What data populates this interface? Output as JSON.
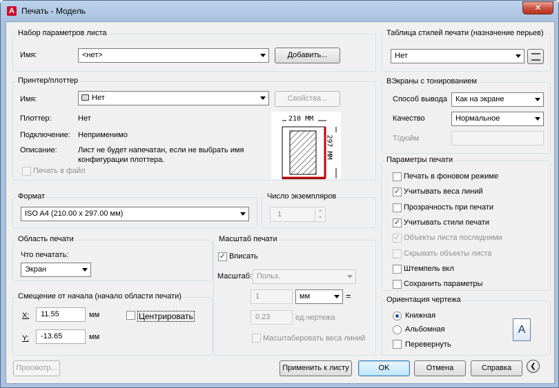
{
  "window": {
    "title": "Печать - Модель",
    "app_logo": "A",
    "close_symbol": "✕"
  },
  "page_setup": {
    "title": "Набор параметров листа",
    "name_label": "Имя:",
    "name_value": "<нет>",
    "add_button": "Добавить..."
  },
  "printer": {
    "title": "Принтер/плоттер",
    "name_label": "Имя:",
    "name_value": "Нет",
    "properties_button": "Свойства...",
    "plotter_label": "Плоттер:",
    "plotter_value": "Нет",
    "connection_label": "Подключение:",
    "connection_value": "Неприменимо",
    "description_label": "Описание:",
    "description_line1": "Лист не будет напечатан, если не выбрать имя",
    "description_line2": "конфигурации плоттера.",
    "print_to_file": "Печать в файл",
    "preview_width": "210 ММ",
    "preview_height": "297 ММ"
  },
  "paper_size": {
    "title": "Формат",
    "value": "ISO A4 (210.00 x 297.00 мм)"
  },
  "copies": {
    "title": "Число экземпляров",
    "value": "1"
  },
  "plot_area": {
    "title": "Область печати",
    "what_label": "Что печатать:",
    "what_value": "Экран"
  },
  "plot_offset": {
    "title": "Смещение от начала (начало области печати)",
    "x_label": "X:",
    "x_value": "11.55",
    "x_unit": "мм",
    "y_label": "Y:",
    "y_value": "-13.65",
    "y_unit": "мм",
    "center_label": "Центрировать"
  },
  "plot_scale": {
    "title": "Масштаб печати",
    "fit_label": "Вписать",
    "scale_label": "Масштаб:",
    "scale_value": "Польз.",
    "value1": "1",
    "unit_value": "мм",
    "equals": "=",
    "value2": "0.23",
    "units_label": "ед.чертежа",
    "scale_lineweights": "Масштабировать веса линий"
  },
  "style_table": {
    "title": "Таблица стилей печати (назначение перьев)",
    "value": "Нет"
  },
  "shaded": {
    "title": "ВЭкраны с тонированием",
    "shade_label": "Способ вывода",
    "shade_value": "Как на экране",
    "quality_label": "Качество",
    "quality_value": "Нормальное",
    "dpi_label": "Т/дюйм"
  },
  "options": {
    "title": "Параметры печати",
    "items": [
      {
        "label": "Печать в фоновом режиме",
        "checked": "",
        "disabled": false
      },
      {
        "label": "Учитывать веса линий",
        "checked": "✓",
        "disabled": false
      },
      {
        "label": "Прозрачность при печати",
        "checked": "",
        "disabled": false
      },
      {
        "label": "Учитывать стили печати",
        "checked": "✓",
        "disabled": false
      },
      {
        "label": "Объекты листа последними",
        "checked": "✓",
        "disabled": true
      },
      {
        "label": "Скрывать объекты листа",
        "checked": "",
        "disabled": true
      },
      {
        "label": "Штемпель вкл",
        "checked": "",
        "disabled": false
      },
      {
        "label": "Сохранить параметры",
        "checked": "",
        "disabled": false
      }
    ]
  },
  "orientation": {
    "title": "Ориентация чертежа",
    "portrait": "Книжная",
    "landscape": "Альбомная",
    "upside_down": "Перевернуть",
    "icon_letter": "A"
  },
  "footer": {
    "preview": "Просмотр...",
    "apply": "Применить к листу",
    "ok": "OK",
    "cancel": "Отмена",
    "help": "Справка",
    "expand_symbol": "❮"
  },
  "checks": {
    "fit": "✓"
  }
}
